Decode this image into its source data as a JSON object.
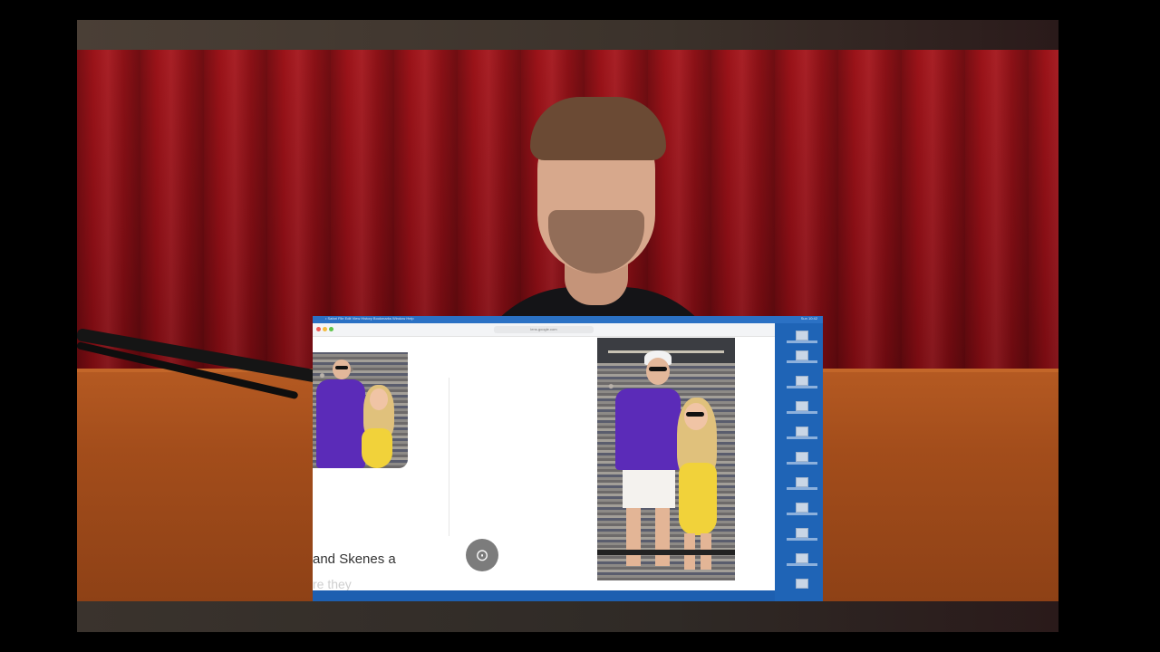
{
  "screen": {
    "menubar_items": "• Safari  File  Edit  View  History  Bookmarks  Window  Help",
    "menubar_status": "Sun 10:42",
    "browser": {
      "address": "lens.google.com",
      "caption_line1": "and Skenes a",
      "caption_line2": "re they",
      "lens_icon": "camera-search-icon"
    }
  },
  "colors": {
    "curtain": "#9a111a",
    "couch": "#a34d1b",
    "desktop": "#1f64b6",
    "jersey": "#5b2bb8",
    "dress": "#f1d23a"
  }
}
